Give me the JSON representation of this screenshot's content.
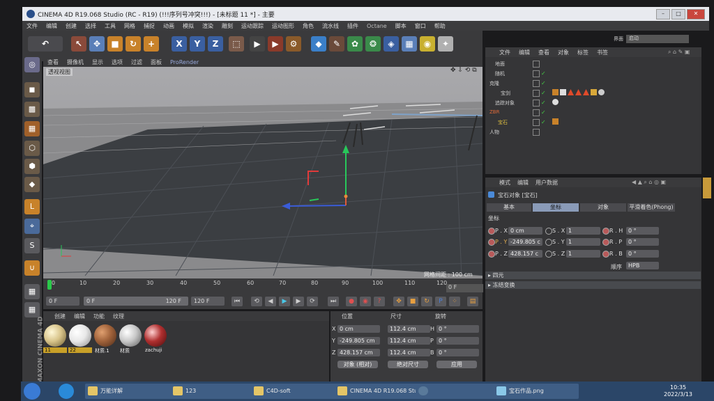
{
  "window": {
    "title": "CINEMA 4D R19.068 Studio (RC - R19) (!!!序列号冲突!!!) - [未标题 11 *] - 主要"
  },
  "menu": [
    "文件",
    "编辑",
    "创建",
    "选择",
    "工具",
    "网格",
    "捕捉",
    "动画",
    "模拟",
    "渲染",
    "雕刻",
    "运动跟踪",
    "运动图形",
    "角色",
    "流水线",
    "插件",
    "Octane",
    "脚本",
    "窗口",
    "帮助"
  ],
  "layout": {
    "label": "界面",
    "value": "启动"
  },
  "viewport": {
    "menu": [
      "查看",
      "摄像机",
      "显示",
      "选项",
      "过滤",
      "面板"
    ],
    "prorender": "ProRender",
    "label": "透视视图",
    "grid_info": "网格间距 : 100 cm"
  },
  "timeline": {
    "ticks": [
      "0",
      "10",
      "20",
      "30",
      "40",
      "50",
      "60",
      "70",
      "80",
      "90",
      "100",
      "110",
      "120"
    ],
    "end_frame": "0 F"
  },
  "transport": {
    "current": "0 F",
    "range_start": "0 F",
    "range_end": "120 F",
    "max": "120 F"
  },
  "materials": {
    "menu": [
      "创建",
      "编辑",
      "功能",
      "纹理"
    ],
    "items": [
      {
        "label": "11",
        "color": "#d8c48a",
        "selected": true
      },
      {
        "label": "22",
        "color": "#e8e8e8",
        "selected": true
      },
      {
        "label": "材质.1",
        "color": "#a0623a",
        "selected": false
      },
      {
        "label": "材质",
        "color": "#c8c8c8",
        "selected": false
      },
      {
        "label": "zachuji",
        "color": "#b03030",
        "selected": false
      }
    ]
  },
  "coords": {
    "headers": [
      "位置",
      "尺寸",
      "旋转"
    ],
    "rows": [
      {
        "axis": "X",
        "pos": "0 cm",
        "size": "112.4 cm",
        "rlabel": "H",
        "rot": "0 °"
      },
      {
        "axis": "Y",
        "pos": "-249.805 cm",
        "size": "112.4 cm",
        "rlabel": "P",
        "rot": "0 °"
      },
      {
        "axis": "Z",
        "pos": "428.157 cm",
        "size": "112.4 cm",
        "rlabel": "B",
        "rot": "0 °"
      }
    ],
    "mode1": "对象 (相对)",
    "mode2": "绝对尺寸",
    "apply": "应用"
  },
  "object_manager": {
    "menu": [
      "文件",
      "编辑",
      "查看",
      "对象",
      "标签",
      "书签"
    ],
    "objects": [
      {
        "name": "地面",
        "indent": 14,
        "color": "#cfcfcf"
      },
      {
        "name": "随机",
        "indent": 14,
        "color": "#cfcfcf"
      },
      {
        "name": "克隆",
        "indent": 6,
        "color": "#cfcfcf"
      },
      {
        "name": "宝剑",
        "indent": 20,
        "color": "#cfcfcf"
      },
      {
        "name": "追踪对象",
        "indent": 14,
        "color": "#cfcfcf"
      },
      {
        "name": "ZBR",
        "indent": 6,
        "color": "#e06a3a"
      },
      {
        "name": "宝石",
        "indent": 18,
        "color": "#e0c040"
      },
      {
        "name": "人物",
        "indent": 6,
        "color": "#cfcfcf"
      }
    ]
  },
  "attributes": {
    "menu": [
      "模式",
      "编辑",
      "用户数据"
    ],
    "title": "宝石对象 [宝石]",
    "tabs": [
      "基本",
      "坐标",
      "对象",
      "平滑着色(Phong)"
    ],
    "active_tab": "坐标",
    "section": "坐标",
    "pos": {
      "x_label": "P . X",
      "x": "0 cm",
      "y_label": "P . Y",
      "y": "-249.805 c",
      "z_label": "P . Z",
      "z": "428.157 c"
    },
    "scale": {
      "x_label": "S . X",
      "x": "1",
      "y_label": "S . Y",
      "y": "1",
      "z_label": "S . Z",
      "z": "1"
    },
    "rot": {
      "h_label": "R . H",
      "h": "0 °",
      "p_label": "R . P",
      "p": "0 °",
      "b_label": "R . B",
      "b": "0 °"
    },
    "order_label": "顺序",
    "order": "HPB",
    "section2": "四元",
    "section3": "冻结变换"
  },
  "taskbar": {
    "tasks": [
      "万能详解",
      "123",
      "C4D-soft",
      "CINEMA 4D R19.068 Studio",
      "",
      "宝石作品.png"
    ],
    "time": "10:35",
    "date": "2022/3/13"
  }
}
